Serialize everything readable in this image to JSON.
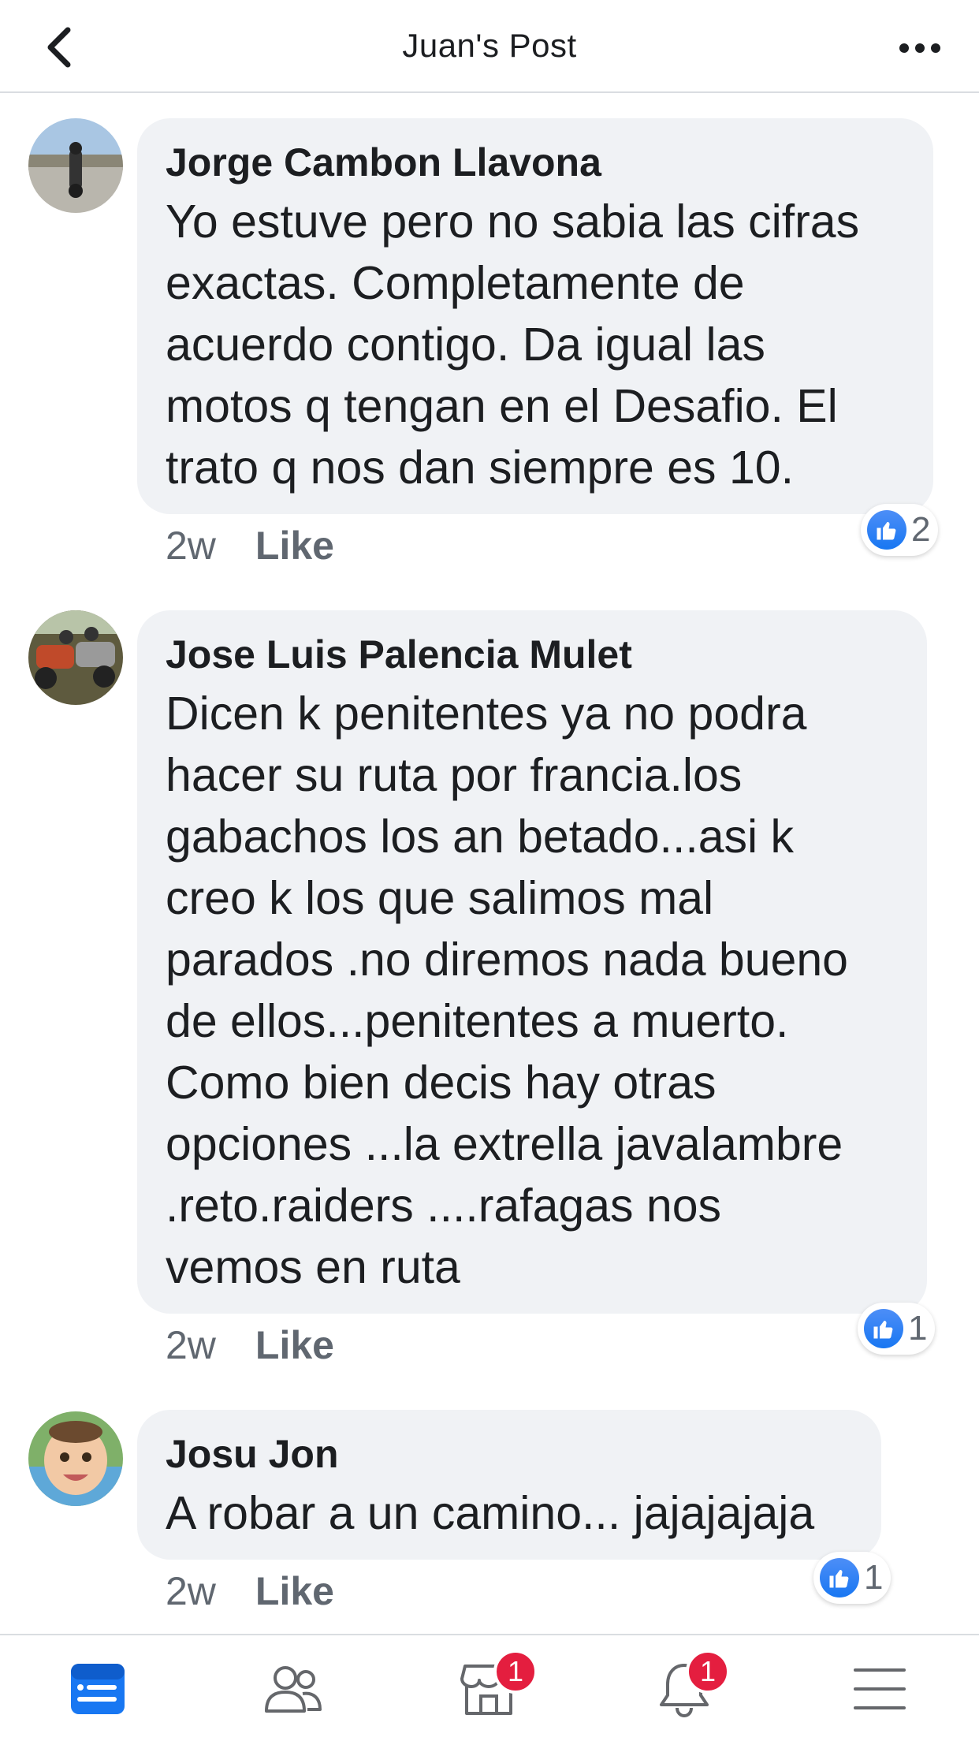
{
  "header": {
    "title": "Juan's Post",
    "back_icon": "chevron-left-icon",
    "more_icon": "more-horizontal-icon"
  },
  "comments": [
    {
      "author": "Jorge Cambon Llavona",
      "lines": [
        "Yo estuve pero no sabia las cifras",
        "exactas. Completamente de",
        "acuerdo contigo. Da igual las",
        "motos q tengan en el Desafio. El",
        "trato q nos dan siempre es 10."
      ],
      "time": "2w",
      "like_label": "Like",
      "reactions": "2"
    },
    {
      "author": "Jose Luis Palencia Mulet",
      "lines": [
        "Dicen k penitentes ya no podra",
        "hacer su ruta por francia.los",
        "gabachos los an betado...asi k",
        "creo k los que salimos mal",
        "parados .no diremos nada bueno",
        "de ellos...penitentes a muerto.",
        "Como bien decis hay otras",
        "opciones ...la extrella javalambre",
        ".reto.raiders ....rafagas nos",
        "vemos en ruta"
      ],
      "time": "2w",
      "like_label": "Like",
      "reactions": "1"
    },
    {
      "author": "Josu Jon",
      "lines": [
        "A robar a un camino... jajajajaja"
      ],
      "time": "2w",
      "like_label": "Like",
      "reactions": "1"
    }
  ],
  "tabbar": {
    "tabs": [
      {
        "name": "news-feed",
        "icon": "news-feed-icon",
        "active": true
      },
      {
        "name": "groups",
        "icon": "groups-icon"
      },
      {
        "name": "marketplace",
        "icon": "marketplace-icon",
        "badge": "1"
      },
      {
        "name": "notifications",
        "icon": "bell-icon",
        "badge": "1"
      },
      {
        "name": "menu",
        "icon": "hamburger-menu-icon"
      }
    ]
  },
  "colors": {
    "accent": "#1877f2",
    "bubble": "#f0f2f5",
    "badge": "#e41e3f",
    "meta": "#606770"
  }
}
